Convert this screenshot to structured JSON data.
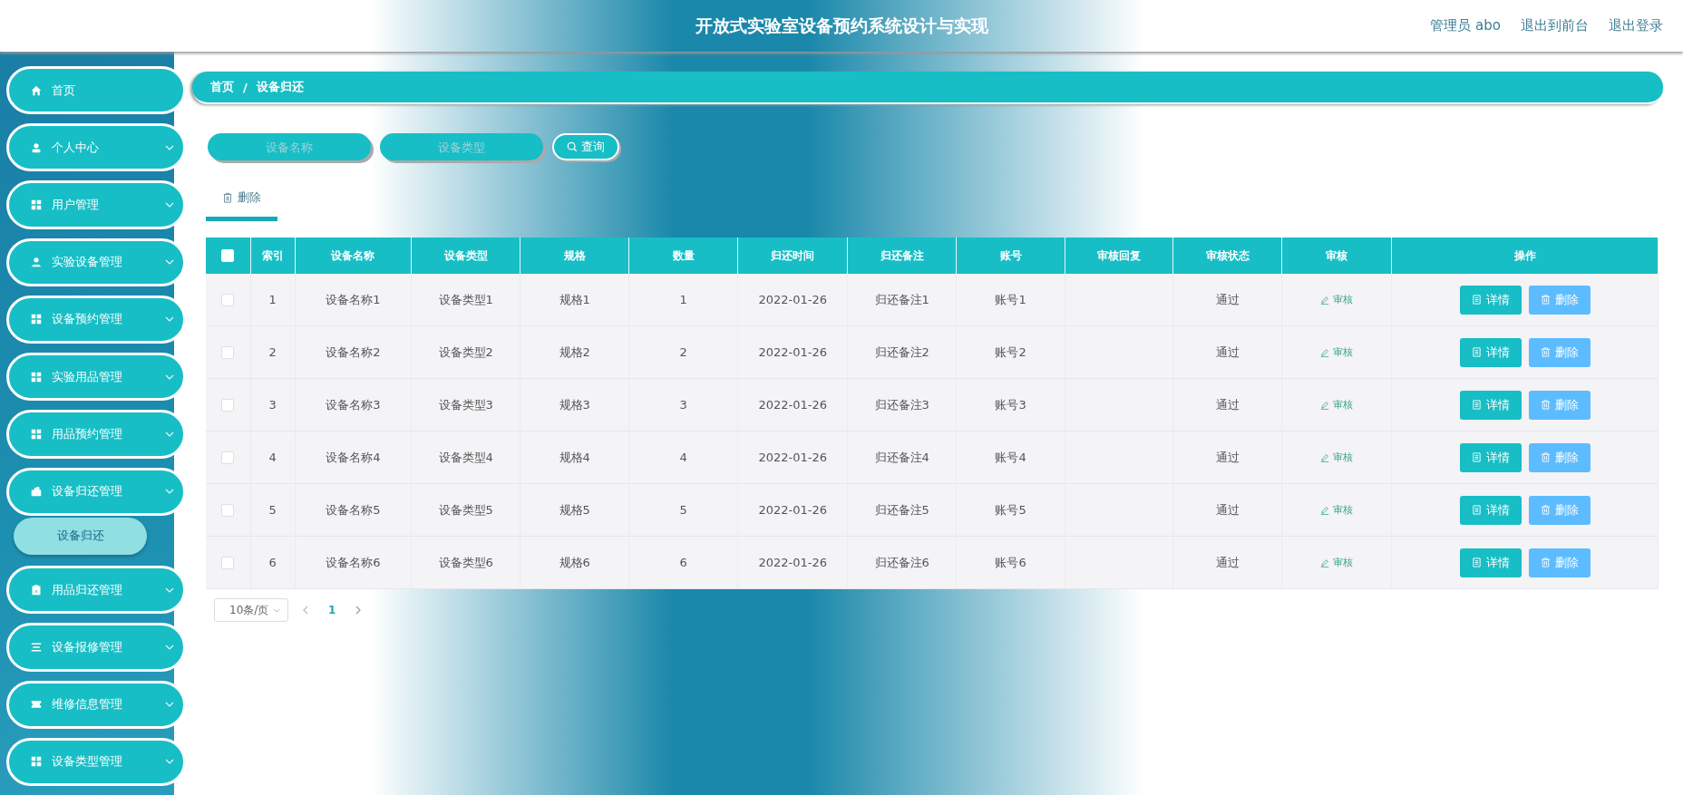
{
  "header": {
    "title": "开放式实验室设备预约系统设计与实现",
    "user": "管理员 abo",
    "links": [
      "退出到前台",
      "退出登录"
    ]
  },
  "sidebar": {
    "items": [
      {
        "label": "首页",
        "kind": "home",
        "has_arrow": false
      },
      {
        "label": "个人中心",
        "kind": "user",
        "has_arrow": true
      },
      {
        "label": "用户管理",
        "kind": "grid",
        "has_arrow": true
      },
      {
        "label": "实验设备管理",
        "kind": "person",
        "has_arrow": true
      },
      {
        "label": "设备预约管理",
        "kind": "grid",
        "has_arrow": true
      },
      {
        "label": "实验用品管理",
        "kind": "grid",
        "has_arrow": true
      },
      {
        "label": "用品预约管理",
        "kind": "grid",
        "has_arrow": true
      },
      {
        "label": "设备归还管理",
        "kind": "wallet",
        "has_arrow": true,
        "children": [
          {
            "label": "设备归还",
            "selected": true
          }
        ]
      },
      {
        "label": "用品归还管理",
        "kind": "clipboard",
        "has_arrow": true
      },
      {
        "label": "设备报修管理",
        "kind": "list",
        "has_arrow": true
      },
      {
        "label": "维修信息管理",
        "kind": "ticket",
        "has_arrow": true
      },
      {
        "label": "设备类型管理",
        "kind": "grid",
        "has_arrow": true
      }
    ]
  },
  "breadcrumb": [
    "首页",
    "/",
    "设备归还"
  ],
  "search": {
    "fields": [
      {
        "placeholder": "设备名称"
      },
      {
        "placeholder": "设备类型"
      }
    ],
    "button": "查询"
  },
  "toolbar": {
    "delete": "删除"
  },
  "table": {
    "header_checked": false,
    "columns": [
      "索引",
      "设备名称",
      "设备类型",
      "规格",
      "数量",
      "归还时间",
      "归还备注",
      "账号",
      "审核回复",
      "审核状态",
      "审核",
      "操作"
    ],
    "rows": [
      {
        "checked": false,
        "cells": [
          "1",
          "设备名称1",
          "设备类型1",
          "规格1",
          "1",
          "2022-01-26",
          "归还备注1",
          "账号1",
          "",
          "通过"
        ],
        "review": "审核",
        "actions": [
          "详情",
          "删除"
        ]
      },
      {
        "checked": false,
        "cells": [
          "2",
          "设备名称2",
          "设备类型2",
          "规格2",
          "2",
          "2022-01-26",
          "归还备注2",
          "账号2",
          "",
          "通过"
        ],
        "review": "审核",
        "actions": [
          "详情",
          "删除"
        ]
      },
      {
        "checked": false,
        "cells": [
          "3",
          "设备名称3",
          "设备类型3",
          "规格3",
          "3",
          "2022-01-26",
          "归还备注3",
          "账号3",
          "",
          "通过"
        ],
        "review": "审核",
        "actions": [
          "详情",
          "删除"
        ]
      },
      {
        "checked": false,
        "cells": [
          "4",
          "设备名称4",
          "设备类型4",
          "规格4",
          "4",
          "2022-01-26",
          "归还备注4",
          "账号4",
          "",
          "通过"
        ],
        "review": "审核",
        "actions": [
          "详情",
          "删除"
        ]
      },
      {
        "checked": false,
        "cells": [
          "5",
          "设备名称5",
          "设备类型5",
          "规格5",
          "5",
          "2022-01-26",
          "归还备注5",
          "账号5",
          "",
          "通过"
        ],
        "review": "审核",
        "actions": [
          "详情",
          "删除"
        ]
      },
      {
        "checked": false,
        "cells": [
          "6",
          "设备名称6",
          "设备类型6",
          "规格6",
          "6",
          "2022-01-26",
          "归还备注6",
          "账号6",
          "",
          "通过"
        ],
        "review": "审核",
        "actions": [
          "详情",
          "删除"
        ]
      }
    ]
  },
  "pagination": {
    "page_size": "10条/页",
    "pages": [
      {
        "label": "1",
        "selected": true
      }
    ]
  }
}
